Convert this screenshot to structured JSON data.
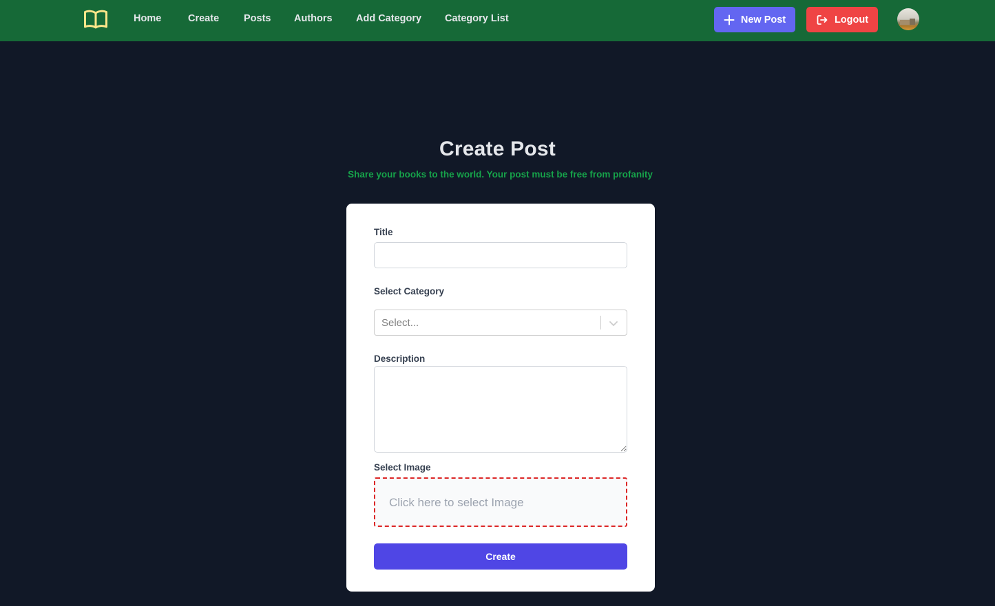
{
  "nav": {
    "logo_icon": "open-book-icon",
    "links": [
      {
        "label": "Home"
      },
      {
        "label": "Create"
      },
      {
        "label": "Posts"
      },
      {
        "label": "Authors"
      },
      {
        "label": "Add Category"
      },
      {
        "label": "Category List"
      }
    ],
    "new_post_label": "New Post",
    "new_post_icon": "plus-icon",
    "logout_label": "Logout",
    "logout_icon": "logout-icon",
    "avatar_icon": "user-avatar"
  },
  "header": {
    "title": "Create Post",
    "subtitle": "Share your books to the world. Your post must be free from profanity"
  },
  "form": {
    "title_label": "Title",
    "title_value": "",
    "category_label": "Select Category",
    "category_placeholder": "Select...",
    "description_label": "Description",
    "description_value": "",
    "image_label": "Select Image",
    "image_placeholder": "Click here to select Image",
    "submit_label": "Create"
  },
  "colors": {
    "navbar": "#166937",
    "page_background": "#111827",
    "new_post_button": "#6366f1",
    "logout_button": "#ef4444",
    "subtitle_text": "#16a34a",
    "logo": "#fde68a",
    "dropzone_border": "#dc2626",
    "submit_button": "#4f46e5"
  }
}
